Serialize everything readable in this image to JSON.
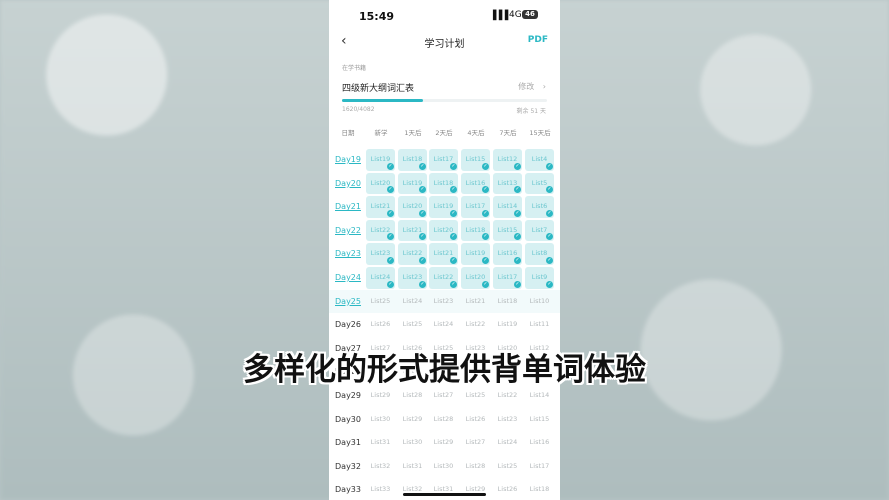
{
  "status": {
    "time": "15:49",
    "signal": "▌▌▌",
    "network": "4G",
    "battery": "46"
  },
  "nav": {
    "back_icon": "‹",
    "title": "学习计划",
    "pdf": "PDF"
  },
  "book": {
    "section_label": "在学书籍",
    "name": "四级新大纲词汇表",
    "edit": "修改",
    "edit_icon": "›",
    "progress_text": "1620/4082",
    "progress_fraction": 0.397,
    "remaining": "剩余 51 天"
  },
  "columns": [
    "日期",
    "新学",
    "1天后",
    "2天后",
    "4天后",
    "7天后",
    "15天后"
  ],
  "rows": [
    {
      "day": "Day19",
      "done": true,
      "cells": [
        "List19",
        "List18",
        "List17",
        "List15",
        "List12",
        "List4"
      ]
    },
    {
      "day": "Day20",
      "done": true,
      "cells": [
        "List20",
        "List19",
        "List18",
        "List16",
        "List13",
        "List5"
      ]
    },
    {
      "day": "Day21",
      "done": true,
      "cells": [
        "List21",
        "List20",
        "List19",
        "List17",
        "List14",
        "List6"
      ]
    },
    {
      "day": "Day22",
      "done": true,
      "cells": [
        "List22",
        "List21",
        "List20",
        "List18",
        "List15",
        "List7"
      ]
    },
    {
      "day": "Day23",
      "done": true,
      "cells": [
        "List23",
        "List22",
        "List21",
        "List19",
        "List16",
        "List8"
      ]
    },
    {
      "day": "Day24",
      "done": true,
      "cells": [
        "List24",
        "List23",
        "List22",
        "List20",
        "List17",
        "List9"
      ]
    },
    {
      "day": "Day25",
      "done": false,
      "current": true,
      "cells": [
        "List25",
        "List24",
        "List23",
        "List21",
        "List18",
        "List10"
      ]
    },
    {
      "day": "Day26",
      "done": false,
      "cells": [
        "List26",
        "List25",
        "List24",
        "List22",
        "List19",
        "List11"
      ]
    },
    {
      "day": "Day27",
      "done": false,
      "cells": [
        "List27",
        "List26",
        "List25",
        "List23",
        "List20",
        "List12"
      ]
    },
    {
      "day": "Day28",
      "done": false,
      "cells": [
        "List28",
        "List27",
        "List26",
        "List24",
        "List21",
        "List13"
      ]
    },
    {
      "day": "Day29",
      "done": false,
      "cells": [
        "List29",
        "List28",
        "List27",
        "List25",
        "List22",
        "List14"
      ]
    },
    {
      "day": "Day30",
      "done": false,
      "cells": [
        "List30",
        "List29",
        "List28",
        "List26",
        "List23",
        "List15"
      ]
    },
    {
      "day": "Day31",
      "done": false,
      "cells": [
        "List31",
        "List30",
        "List29",
        "List27",
        "List24",
        "List16"
      ]
    },
    {
      "day": "Day32",
      "done": false,
      "cells": [
        "List32",
        "List31",
        "List30",
        "List28",
        "List25",
        "List17"
      ]
    },
    {
      "day": "Day33",
      "done": false,
      "cells": [
        "List33",
        "List32",
        "List31",
        "List29",
        "List26",
        "List18"
      ]
    }
  ],
  "check_icon": "✓",
  "caption": "多样化的形式提供背单词体验",
  "colors": {
    "accent": "#2bb8c4",
    "done_cell": "#d6f0f2"
  }
}
